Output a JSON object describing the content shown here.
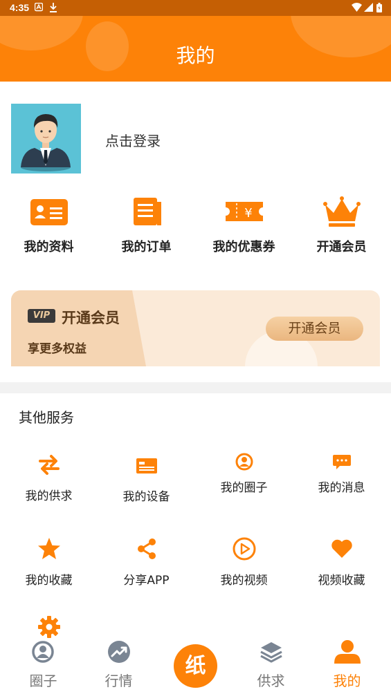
{
  "status_bar": {
    "time": "4:35"
  },
  "header": {
    "title": "我的"
  },
  "profile": {
    "login_text": "点击登录"
  },
  "quick_actions": [
    {
      "label": "我的资料",
      "icon": "profile-card-icon"
    },
    {
      "label": "我的订单",
      "icon": "order-list-icon"
    },
    {
      "label": "我的优惠券",
      "icon": "coupon-icon"
    },
    {
      "label": "开通会员",
      "icon": "crown-icon"
    }
  ],
  "vip": {
    "badge": "VIP",
    "title": "开通会员",
    "subtitle": "享更多权益",
    "button": "开通会员"
  },
  "services": {
    "title": "其他服务",
    "items": [
      {
        "label": "我的供求",
        "icon": "swap-arrows-icon"
      },
      {
        "label": "我的设备",
        "icon": "device-icon"
      },
      {
        "label": "我的圈子",
        "icon": "circle-user-icon"
      },
      {
        "label": "我的消息",
        "icon": "message-icon"
      },
      {
        "label": "我的收藏",
        "icon": "star-icon"
      },
      {
        "label": "分享APP",
        "icon": "share-icon"
      },
      {
        "label": "我的视频",
        "icon": "play-icon"
      },
      {
        "label": "视频收藏",
        "icon": "heart-icon"
      },
      {
        "label": "",
        "icon": "settings-gear-icon"
      }
    ]
  },
  "tabbar": {
    "tabs": [
      {
        "label": "圈子",
        "icon": "circle-user-icon",
        "active": false
      },
      {
        "label": "行情",
        "icon": "trend-icon",
        "active": false
      },
      {
        "label": "供求",
        "icon": "layers-icon",
        "active": false
      },
      {
        "label": "我的",
        "icon": "person-icon",
        "active": true
      }
    ],
    "center_label": "纸"
  },
  "colors": {
    "accent": "#fd8208",
    "status_bar": "#c55f04",
    "vip_text": "#5a3a1a"
  }
}
